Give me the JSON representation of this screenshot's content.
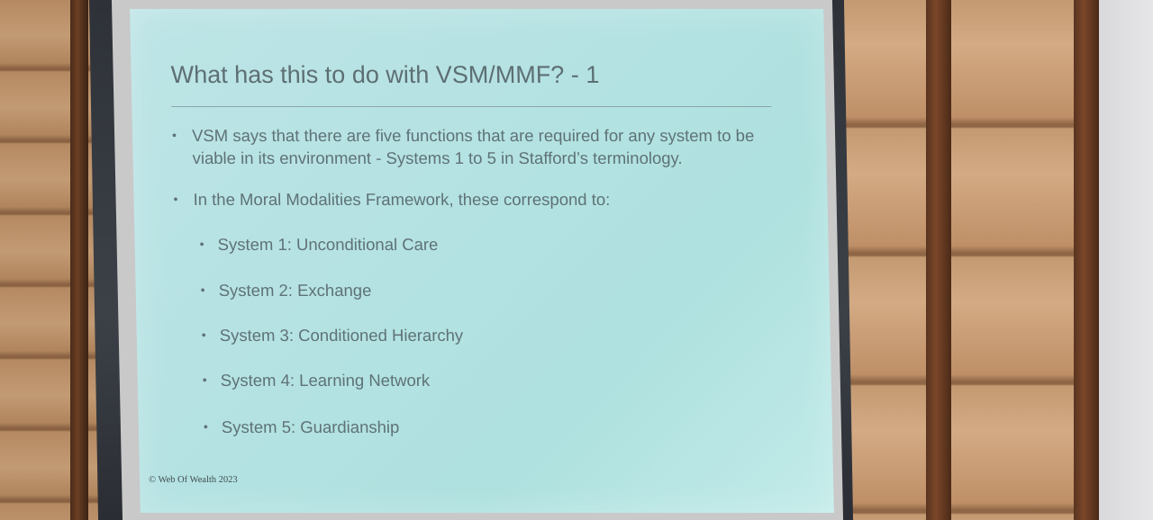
{
  "slide": {
    "title": "What has this to do with VSM/MMF? - 1",
    "bullet_symbol": "•",
    "bullets": [
      {
        "text": "VSM says that there are five functions that are required for any system to be viable in its environment - Systems 1 to 5 in Stafford’s terminology."
      },
      {
        "text": "In the Moral Modalities Framework, these correspond to:"
      }
    ],
    "sub_bullets": [
      {
        "text": "System 1: Unconditional Care"
      },
      {
        "text": "System 2: Exchange"
      },
      {
        "text": "System 3: Conditioned Hierarchy"
      },
      {
        "text": "System 4: Learning Network"
      },
      {
        "text": "System 5: Guardianship"
      }
    ],
    "footer": "© Web Of Wealth 2023",
    "colors": {
      "slide_background": "#b5e2e3",
      "text": "#5e7276",
      "frame": "#2e3238",
      "wood": "#c49a72"
    }
  }
}
